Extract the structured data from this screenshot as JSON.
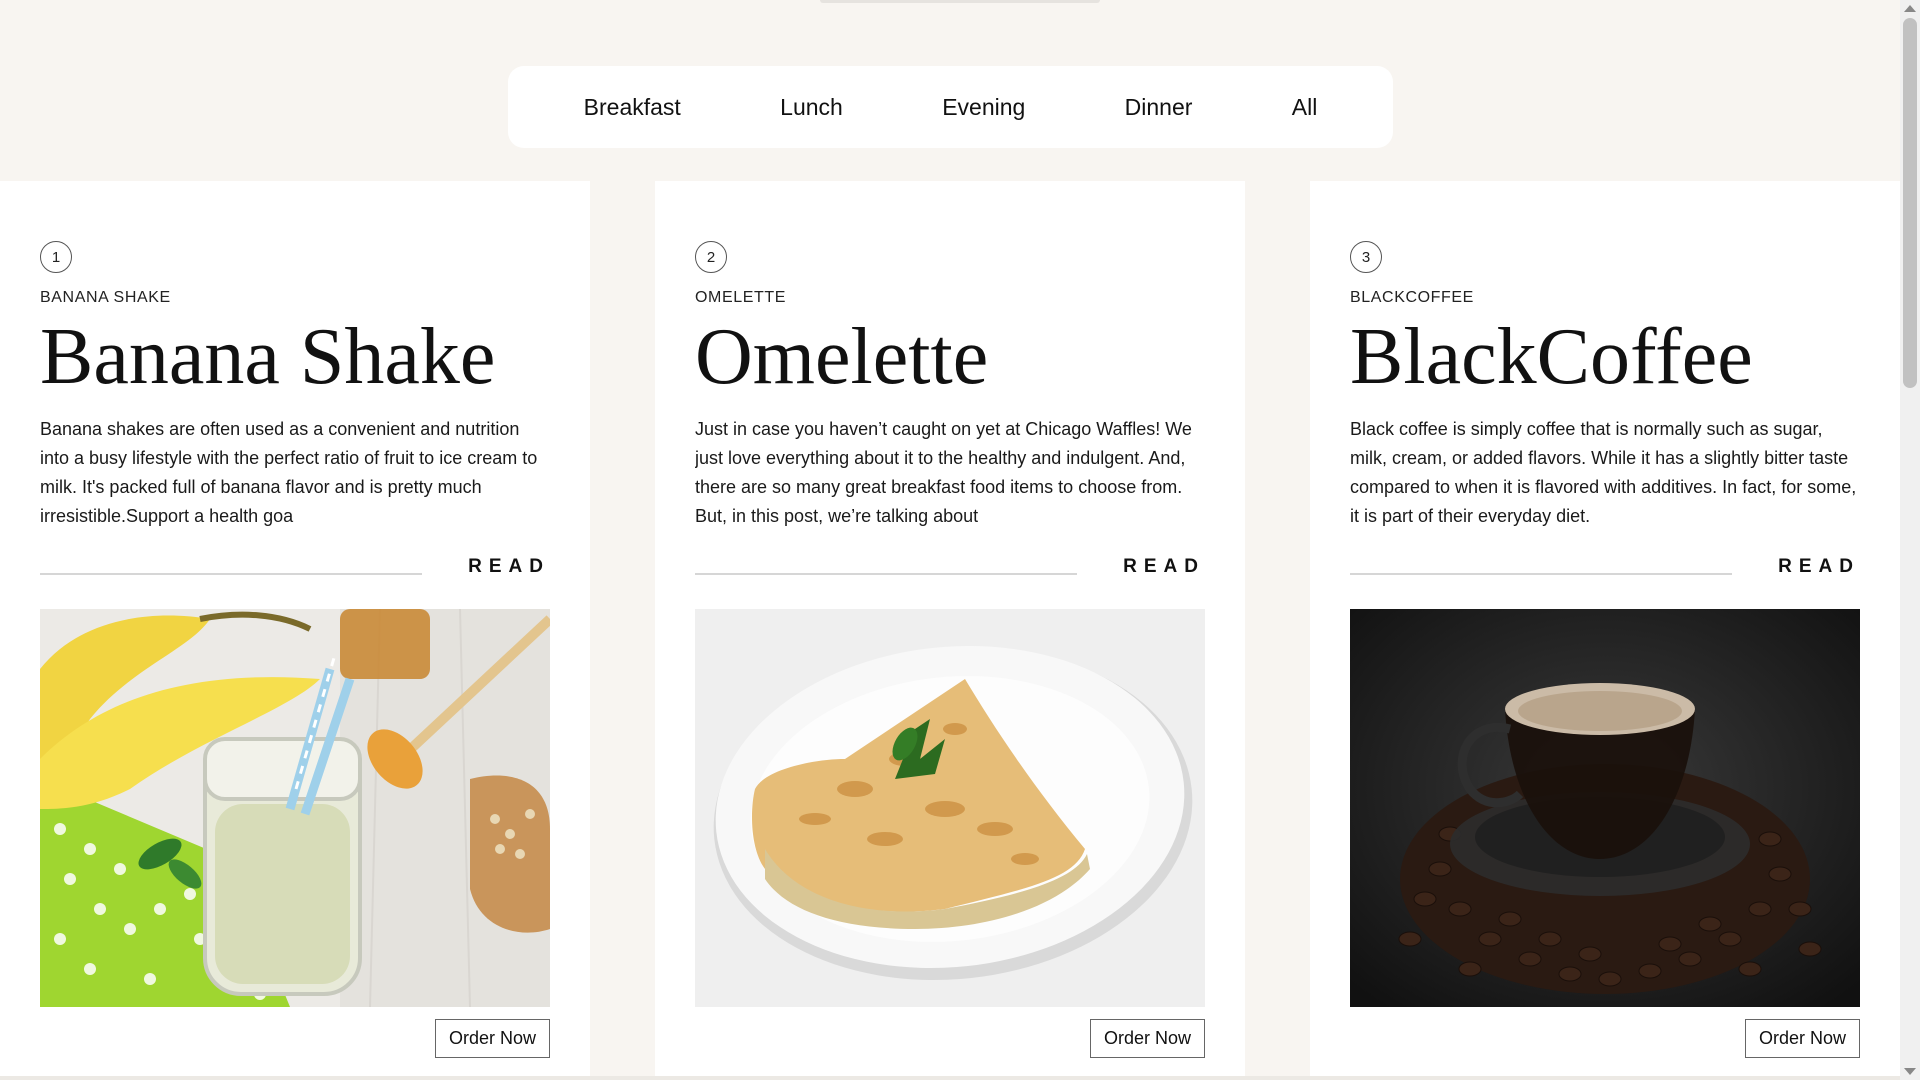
{
  "nav": {
    "tabs": [
      {
        "label": "Breakfast"
      },
      {
        "label": "Lunch"
      },
      {
        "label": "Evening"
      },
      {
        "label": "Dinner"
      },
      {
        "label": "All"
      }
    ]
  },
  "cards": [
    {
      "number": "1",
      "subtitle": "BANANA SHAKE",
      "title": "Banana Shake",
      "description": "Banana shakes are often used as a convenient and nutrition into a busy lifestyle with the perfect ratio of fruit to ice cream to milk. It's packed full of banana flavor and is pretty much irresistible.Support a health goa",
      "read_label": "READ",
      "image": "banana-shake-photo",
      "order_label": "Order Now"
    },
    {
      "number": "2",
      "subtitle": "OMELETTE",
      "title": "Omelette",
      "description": "Just in case you haven’t caught on yet at Chicago Waffles! We just love everything about it to the healthy and indulgent. And, there are so many great breakfast food items to choose from. But, in this post, we’re talking about",
      "read_label": "READ",
      "image": "omelette-photo",
      "order_label": "Order Now"
    },
    {
      "number": "3",
      "subtitle": "BLACKCOFFEE",
      "title": "BlackCoffee",
      "description": "Black coffee is simply coffee that is normally such as sugar, milk, cream, or added flavors. While it has a slightly bitter taste compared to when it is flavored with additives. In fact, for some, it is part of their everyday diet.",
      "read_label": "READ",
      "image": "black-coffee-photo",
      "order_label": "Order Now"
    }
  ],
  "colors": {
    "page_background": "#f8f5f1",
    "card_background": "#ffffff",
    "text": "#111111"
  }
}
